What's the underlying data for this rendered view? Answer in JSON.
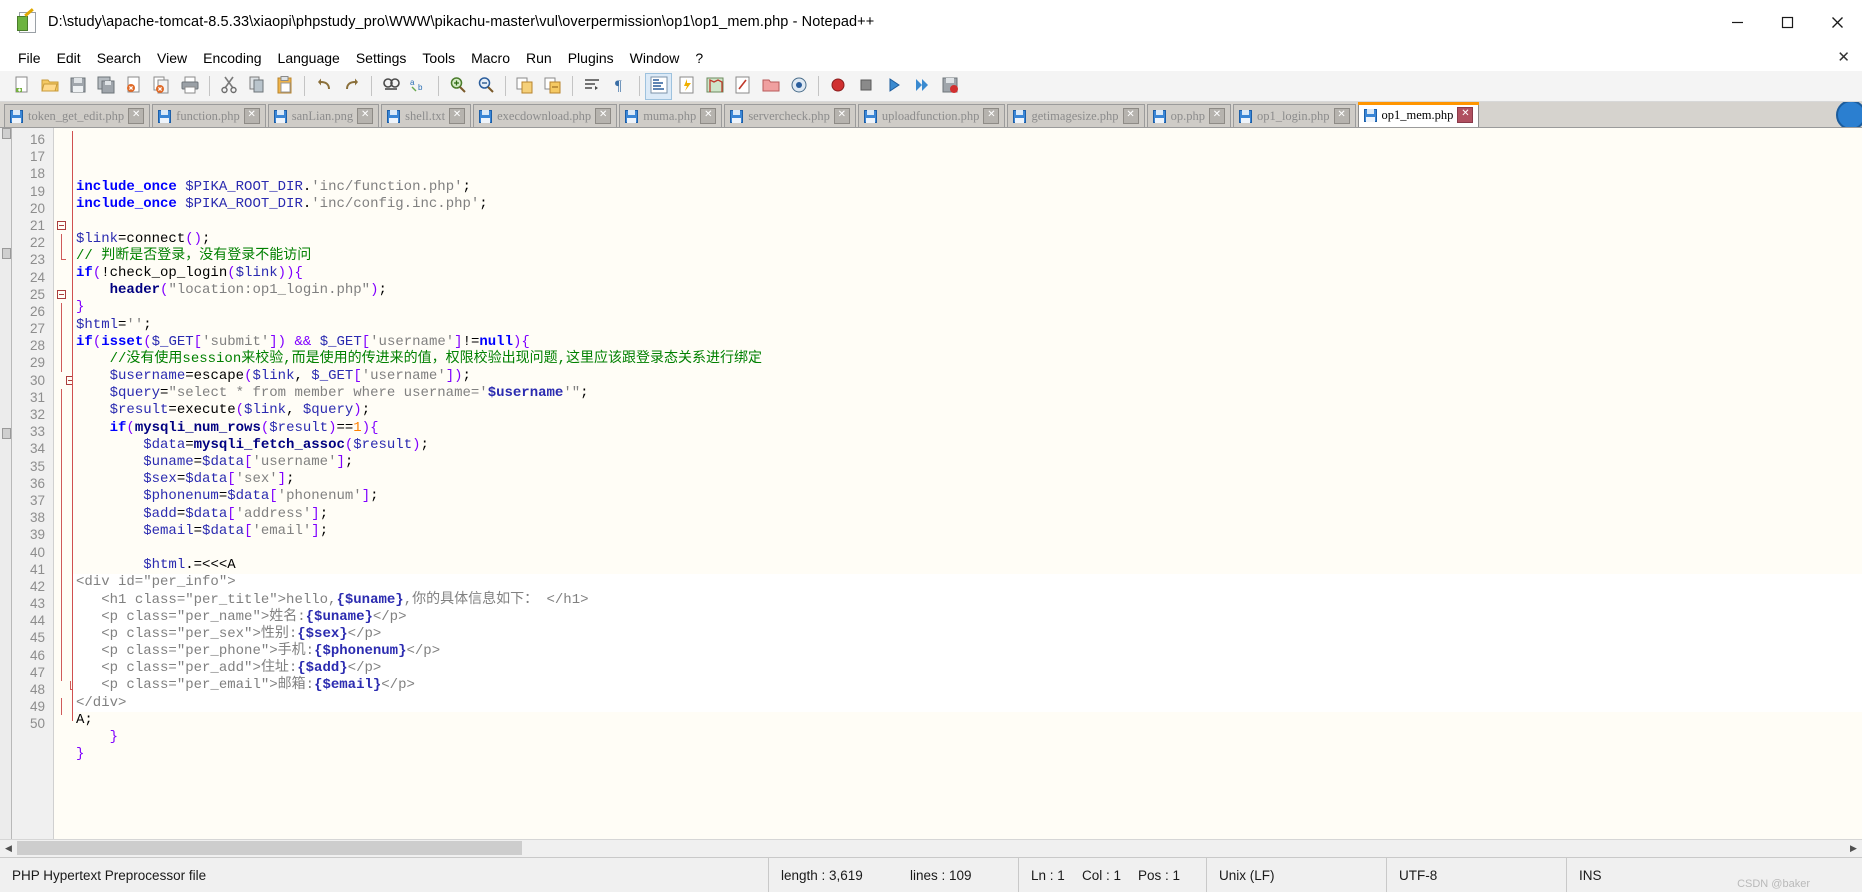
{
  "window": {
    "title": "D:\\study\\apache-tomcat-8.5.33\\xiaopi\\phpstudy_pro\\WWW\\pikachu-master\\vul\\overpermission\\op1\\op1_mem.php - Notepad++",
    "icon": "notepad-plus-plus-icon",
    "minimize_label": "–",
    "maximize_label": "□",
    "close_label": "✕"
  },
  "menu": {
    "items": [
      "File",
      "Edit",
      "Search",
      "View",
      "Encoding",
      "Language",
      "Settings",
      "Tools",
      "Macro",
      "Run",
      "Plugins",
      "Window",
      "?"
    ],
    "close_doc_label": "✕"
  },
  "toolbar": {
    "buttons": [
      {
        "name": "new-file-icon",
        "group": 0
      },
      {
        "name": "open-file-icon",
        "group": 0
      },
      {
        "name": "save-icon",
        "group": 0
      },
      {
        "name": "save-all-icon",
        "group": 0
      },
      {
        "name": "close-file-icon",
        "group": 0
      },
      {
        "name": "close-all-files-icon",
        "group": 0
      },
      {
        "name": "print-icon",
        "group": 0
      },
      {
        "name": "cut-icon",
        "group": 1
      },
      {
        "name": "copy-icon",
        "group": 1
      },
      {
        "name": "paste-icon",
        "group": 1
      },
      {
        "name": "undo-icon",
        "group": 2
      },
      {
        "name": "redo-icon",
        "group": 2
      },
      {
        "name": "find-icon",
        "group": 3
      },
      {
        "name": "replace-icon",
        "group": 3
      },
      {
        "name": "zoom-in-icon",
        "group": 4
      },
      {
        "name": "zoom-out-icon",
        "group": 4
      },
      {
        "name": "sync-vertical-scroll-icon",
        "group": 5
      },
      {
        "name": "sync-horizontal-scroll-icon",
        "group": 5
      },
      {
        "name": "word-wrap-icon",
        "group": 6
      },
      {
        "name": "show-all-characters-icon",
        "group": 6
      },
      {
        "name": "indent-guide-icon",
        "group": 7
      },
      {
        "name": "user-defined-language-icon",
        "group": 7
      },
      {
        "name": "document-map-icon",
        "group": 7
      },
      {
        "name": "function-list-icon",
        "group": 7
      },
      {
        "name": "folder-as-workspace-icon",
        "group": 7
      },
      {
        "name": "monitoring-icon",
        "group": 7
      },
      {
        "name": "start-record-macro-icon",
        "group": 8
      },
      {
        "name": "stop-record-macro-icon",
        "group": 8
      },
      {
        "name": "playback-macro-icon",
        "group": 8
      },
      {
        "name": "run-macro-multiple-icon",
        "group": 8
      },
      {
        "name": "save-macro-icon",
        "group": 8
      }
    ]
  },
  "tabs": [
    {
      "label": "token_get_edit.php",
      "active": false
    },
    {
      "label": "function.php",
      "active": false
    },
    {
      "label": "sanLian.png",
      "active": false
    },
    {
      "label": "shell.txt",
      "active": false
    },
    {
      "label": "execdownload.php",
      "active": false
    },
    {
      "label": "muma.php",
      "active": false
    },
    {
      "label": "servercheck.php",
      "active": false
    },
    {
      "label": "uploadfunction.php",
      "active": false
    },
    {
      "label": "getimagesize.php",
      "active": false
    },
    {
      "label": "op.php",
      "active": false
    },
    {
      "label": "op1_login.php",
      "active": false
    },
    {
      "label": "op1_mem.php",
      "active": true
    }
  ],
  "tab_close_label": "✕",
  "editor": {
    "first_line": 16,
    "last_line": 50,
    "lines": [
      {
        "n": 16,
        "html": "<span class=\"kw\">include_once</span> <span class=\"var\">$PIKA_ROOT_DIR</span><span class=\"pl\">.</span><span class=\"s\">'inc/function.php'</span><span class=\"pl\">;</span>",
        "bg": "hl"
      },
      {
        "n": 17,
        "html": "<span class=\"kw\">include_once</span> <span class=\"var\">$PIKA_ROOT_DIR</span><span class=\"pl\">.</span><span class=\"s\">'inc/config.inc.php'</span><span class=\"pl\">;</span>",
        "bg": "hl"
      },
      {
        "n": 18,
        "html": "",
        "bg": "hl"
      },
      {
        "n": 19,
        "html": "<span class=\"var\">$link</span><span class=\"pl\">=</span><span class=\"pl\">connect</span><span class=\"op\">()</span><span class=\"pl\">;</span>",
        "bg": "hl"
      },
      {
        "n": 20,
        "html": "<span class=\"cm\">// 判断是否登录，没有登录不能访问</span>",
        "bg": "hl"
      },
      {
        "n": 21,
        "html": "<span class=\"kw\">if</span><span class=\"op\">(</span><span class=\"pl\">!check_op_login</span><span class=\"op\">(</span><span class=\"var\">$link</span><span class=\"op\">))</span><span class=\"op\">{</span>",
        "bg": "hl"
      },
      {
        "n": 22,
        "html": "    <span class=\"fnb\">header</span><span class=\"op\">(</span><span class=\"s\">\"location:op1_login.php\"</span><span class=\"op\">)</span><span class=\"pl\">;</span>",
        "bg": "hl"
      },
      {
        "n": 23,
        "html": "<span class=\"op\">}</span>",
        "bg": "hl"
      },
      {
        "n": 24,
        "html": "<span class=\"var\">$html</span><span class=\"pl\">=</span><span class=\"s\">''</span><span class=\"pl\">;</span>",
        "bg": "hl"
      },
      {
        "n": 25,
        "html": "<span class=\"kw\">if</span><span class=\"op\">(</span><span class=\"kw\">isset</span><span class=\"op\">(</span><span class=\"var\">$_GET</span><span class=\"op\">[</span><span class=\"s\">'submit'</span><span class=\"op\">])</span> <span class=\"op\">&amp;&amp;</span> <span class=\"var\">$_GET</span><span class=\"op\">[</span><span class=\"s\">'username'</span><span class=\"op\">]</span><span class=\"pl\">!=</span><span class=\"kw\">null</span><span class=\"op\">){</span>",
        "bg": "hl"
      },
      {
        "n": 26,
        "html": "    <span class=\"cm\">//没有使用session来校验,而是使用的传进来的值，权限校验出现问题,这里应该跟登录态关系进行绑定</span>",
        "bg": "hl"
      },
      {
        "n": 27,
        "html": "    <span class=\"var\">$username</span><span class=\"pl\">=</span><span class=\"pl\">escape</span><span class=\"op\">(</span><span class=\"var\">$link</span><span class=\"pl\">,</span> <span class=\"var\">$_GET</span><span class=\"op\">[</span><span class=\"s\">'username'</span><span class=\"op\">])</span><span class=\"pl\">;</span>",
        "bg": "hl"
      },
      {
        "n": 28,
        "html": "    <span class=\"var\">$query</span><span class=\"pl\">=</span><span class=\"s\">\"select * from member where username='</span><span class=\"var\"><b>$username</b></span><span class=\"s\">'\"</span><span class=\"pl\">;</span>",
        "bg": "hl"
      },
      {
        "n": 29,
        "html": "    <span class=\"var\">$result</span><span class=\"pl\">=</span><span class=\"pl\">execute</span><span class=\"op\">(</span><span class=\"var\">$link</span><span class=\"pl\">,</span> <span class=\"var\">$query</span><span class=\"op\">)</span><span class=\"pl\">;</span>",
        "bg": "hl"
      },
      {
        "n": 30,
        "html": "    <span class=\"kw\">if</span><span class=\"op\">(</span><span class=\"fnb\">mysqli_num_rows</span><span class=\"op\">(</span><span class=\"var\">$result</span><span class=\"op\">)</span><span class=\"pl\">==</span><span class=\"num\">1</span><span class=\"op\">){</span>",
        "bg": "hl"
      },
      {
        "n": 31,
        "html": "        <span class=\"var\">$data</span><span class=\"pl\">=</span><span class=\"fnb\">mysqli_fetch_assoc</span><span class=\"op\">(</span><span class=\"var\">$result</span><span class=\"op\">)</span><span class=\"pl\">;</span>",
        "bg": "hl"
      },
      {
        "n": 32,
        "html": "        <span class=\"var\">$uname</span><span class=\"pl\">=</span><span class=\"var\">$data</span><span class=\"op\">[</span><span class=\"s\">'username'</span><span class=\"op\">]</span><span class=\"pl\">;</span>",
        "bg": "hl"
      },
      {
        "n": 33,
        "html": "        <span class=\"var\">$sex</span><span class=\"pl\">=</span><span class=\"var\">$data</span><span class=\"op\">[</span><span class=\"s\">'sex'</span><span class=\"op\">]</span><span class=\"pl\">;</span>",
        "bg": "hl"
      },
      {
        "n": 34,
        "html": "        <span class=\"var\">$phonenum</span><span class=\"pl\">=</span><span class=\"var\">$data</span><span class=\"op\">[</span><span class=\"s\">'phonenum'</span><span class=\"op\">]</span><span class=\"pl\">;</span>",
        "bg": "hl"
      },
      {
        "n": 35,
        "html": "        <span class=\"var\">$add</span><span class=\"pl\">=</span><span class=\"var\">$data</span><span class=\"op\">[</span><span class=\"s\">'address'</span><span class=\"op\">]</span><span class=\"pl\">;</span>",
        "bg": "hl"
      },
      {
        "n": 36,
        "html": "        <span class=\"var\">$email</span><span class=\"pl\">=</span><span class=\"var\">$data</span><span class=\"op\">[</span><span class=\"s\">'email'</span><span class=\"op\">]</span><span class=\"pl\">;</span>",
        "bg": "hl"
      },
      {
        "n": 37,
        "html": "",
        "bg": "hl"
      },
      {
        "n": 38,
        "html": "        <span class=\"var\">$html</span><span class=\"pl\">.=</span><span class=\"pl\">&lt;&lt;&lt;A</span>",
        "bg": "hl"
      },
      {
        "n": 39,
        "html": "<span class=\"tag\">&lt;div id=\"per_info\"&gt;</span>",
        "bg": "str"
      },
      {
        "n": 40,
        "html": "   <span class=\"tag\">&lt;h1 class=\"per_title\"&gt;hello,</span><span class=\"var\"><b>{$uname}</b></span><span class=\"tag\">,你的具体信息如下： &lt;/h1&gt;</span>",
        "bg": "str"
      },
      {
        "n": 41,
        "html": "   <span class=\"tag\">&lt;p class=\"per_name\"&gt;姓名:</span><span class=\"var\"><b>{$uname}</b></span><span class=\"tag\">&lt;/p&gt;</span>",
        "bg": "str"
      },
      {
        "n": 42,
        "html": "   <span class=\"tag\">&lt;p class=\"per_sex\"&gt;性别:</span><span class=\"var\"><b>{$sex}</b></span><span class=\"tag\">&lt;/p&gt;</span>",
        "bg": "str"
      },
      {
        "n": 43,
        "html": "   <span class=\"tag\">&lt;p class=\"per_phone\"&gt;手机:</span><span class=\"var\"><b>{$phonenum}</b></span><span class=\"tag\">&lt;/p&gt;</span>",
        "bg": "str"
      },
      {
        "n": 44,
        "html": "   <span class=\"tag\">&lt;p class=\"per_add\"&gt;住址:</span><span class=\"var\"><b>{$add}</b></span><span class=\"tag\">&lt;/p&gt;</span>",
        "bg": "str"
      },
      {
        "n": 45,
        "html": "   <span class=\"tag\">&lt;p class=\"per_email\"&gt;邮箱:</span><span class=\"var\"><b>{$email}</b></span><span class=\"tag\">&lt;/p&gt;</span>",
        "bg": "str"
      },
      {
        "n": 46,
        "html": "<span class=\"tag\">&lt;/div&gt;</span>",
        "bg": "str"
      },
      {
        "n": 47,
        "html": "<span class=\"pl\">A;</span>",
        "bg": "hl"
      },
      {
        "n": 48,
        "html": "    <span class=\"op\">}</span>",
        "bg": "hl"
      },
      {
        "n": 49,
        "html": "<span class=\"op\">}</span>",
        "bg": "hl"
      },
      {
        "n": 50,
        "html": "",
        "bg": "hl"
      }
    ]
  },
  "hscroll": {
    "left_arrow": "◀",
    "right_arrow": "▶"
  },
  "status": {
    "doc_type": "PHP Hypertext Preprocessor file",
    "length_label": "length : 3,619",
    "lines_label": "lines : 109",
    "ln": "Ln : 1",
    "col": "Col : 1",
    "pos": "Pos : 1",
    "eol": "Unix (LF)",
    "encoding": "UTF-8",
    "insert_mode": "INS",
    "watermark": "CSDN @baker"
  },
  "colors": {
    "accent_tab": "#ff9500",
    "keyword": "#0000ff",
    "string": "#808080",
    "comment": "#008000",
    "variable": "#2b2bb0",
    "operator": "#8000ff",
    "number": "#ff8000"
  }
}
